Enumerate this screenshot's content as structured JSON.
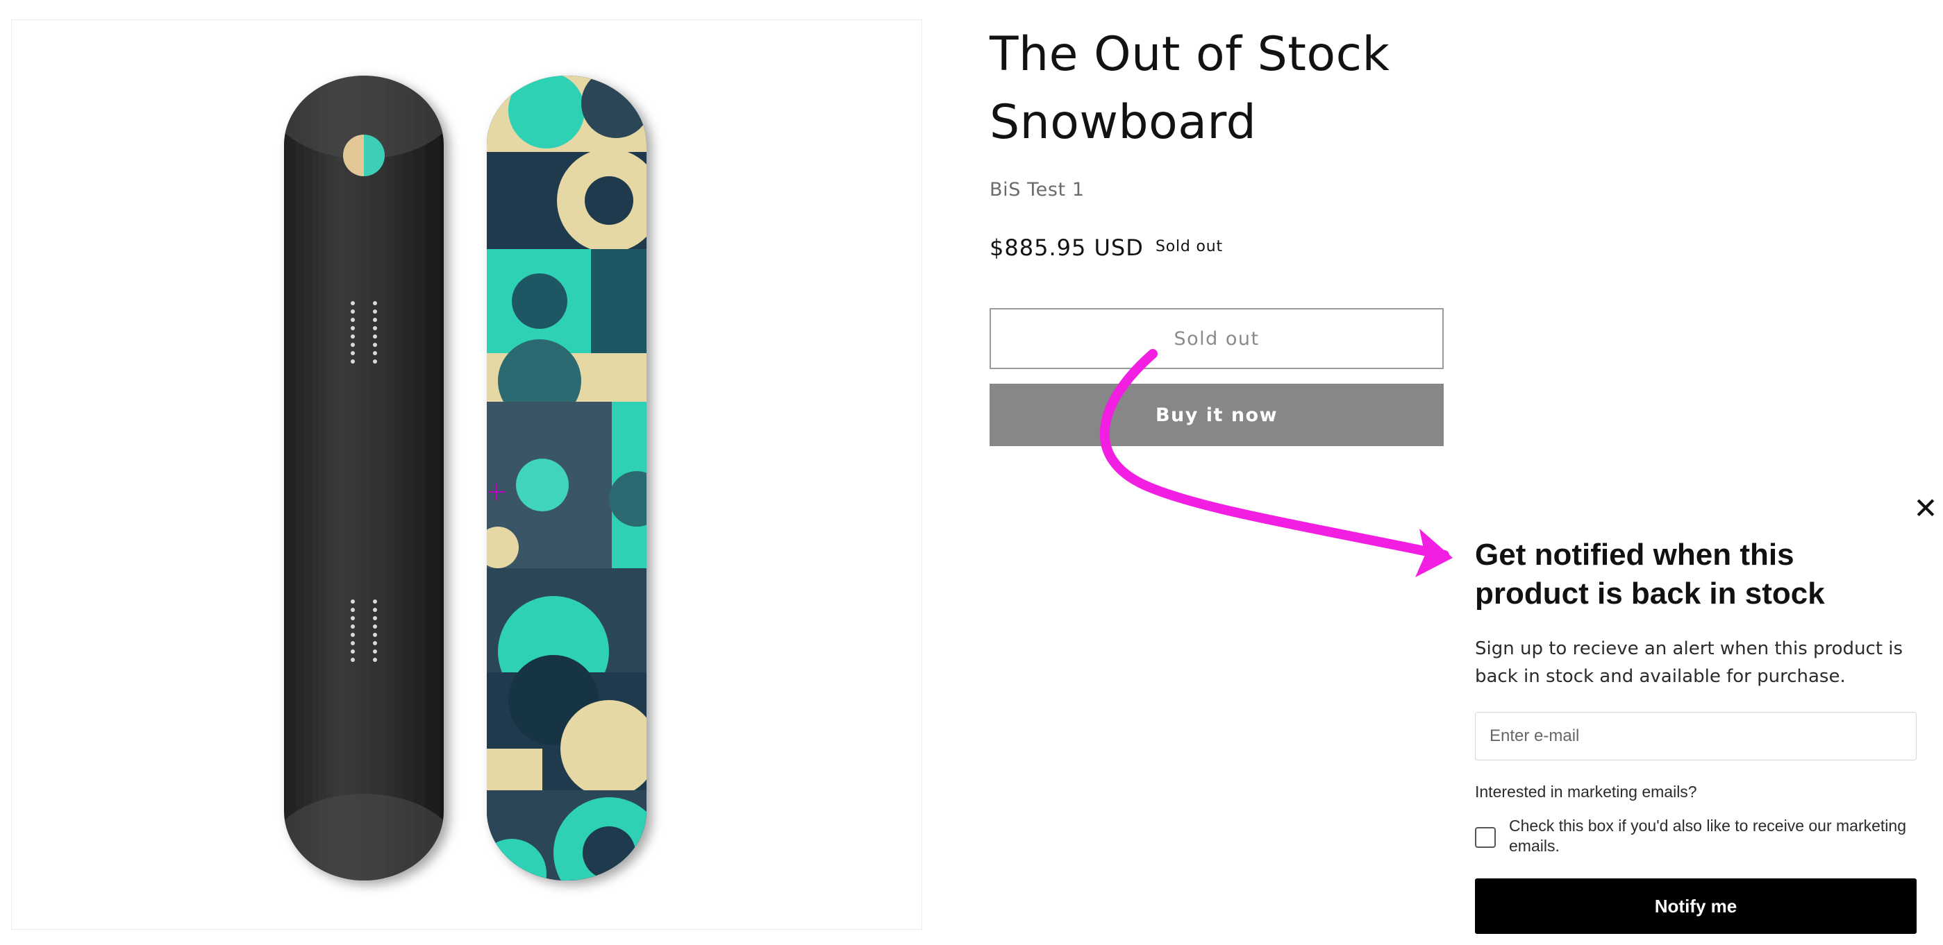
{
  "product": {
    "title": "The Out of Stock Snowboard",
    "vendor": "BiS Test 1",
    "price": "$885.95 USD",
    "badge": "Sold out",
    "sold_out_button": "Sold out",
    "buy_button": "Buy it now"
  },
  "popup": {
    "close_symbol": "✕",
    "title": "Get notified when this product is back in stock",
    "description": "Sign up to recieve an alert when this product is back in stock and available for purchase.",
    "email_placeholder": "Enter e-mail",
    "marketing_question": "Interested in marketing emails?",
    "marketing_checkbox_label": "Check this box if you'd also like to receive our marketing emails.",
    "marketing_checked": false,
    "notify_button": "Notify me"
  },
  "colors": {
    "annotation_arrow": "#f21fe3",
    "buy_button_bg": "#878787",
    "notify_button_bg": "#000000",
    "board_teal": "#2ed1b4",
    "board_navy": "#1f3a4d",
    "board_cream": "#e5d8a5"
  },
  "icons": {
    "close": "close-icon",
    "cursor": "crosshair-cursor-icon",
    "annotation": "arrow-annotation-icon"
  }
}
